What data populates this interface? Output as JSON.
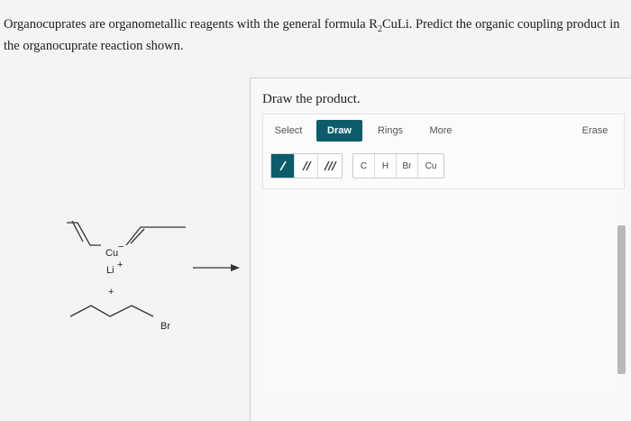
{
  "question": {
    "part1": "Organocuprates are organometallic reagents with the general formula R",
    "subscript": "2",
    "part2": "CuLi. Predict the organic coupling product in the organocuprate reaction shown."
  },
  "panel": {
    "prompt": "Draw the product.",
    "tabs": [
      "Select",
      "Draw",
      "Rings",
      "More",
      "Erase"
    ],
    "bonds": [
      "single-bond-icon",
      "double-bond-icon",
      "triple-bond-icon"
    ],
    "atoms": [
      "C",
      "H",
      "Br",
      "Cu"
    ]
  },
  "reaction": {
    "cu_label": "Cu",
    "cu_charge": "−",
    "li_label": "Li",
    "li_charge": "+",
    "plus": "+",
    "br_label": "Br"
  },
  "colors": {
    "accent": "#0d5c6b"
  }
}
